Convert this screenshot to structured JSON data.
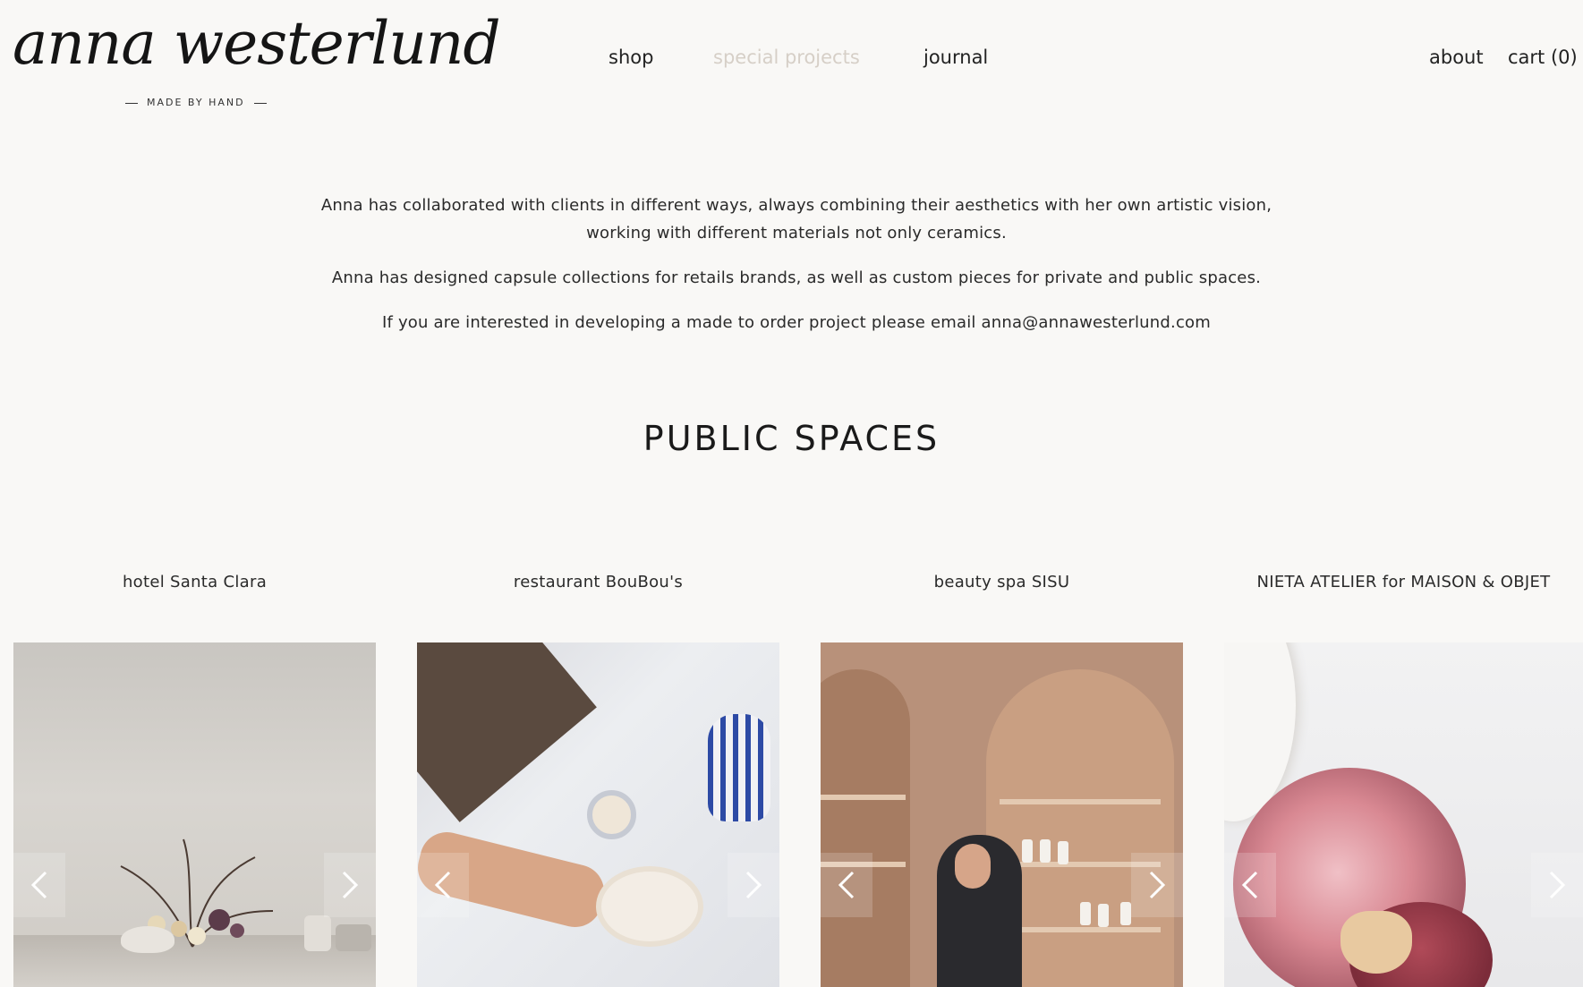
{
  "brand": {
    "name": "anna westerlund",
    "tagline": "MADE BY HAND"
  },
  "nav": {
    "shop": "shop",
    "special_projects": "special projects",
    "journal": "journal",
    "about": "about",
    "cart": "cart (0)"
  },
  "intro": {
    "p1": "Anna has collaborated with clients in different ways, always combining their aesthetics with her own artistic vision, working with different materials not only ceramics.",
    "p2": "Anna has designed capsule collections for retails brands, as well as custom pieces for private and public spaces.",
    "p3": "If you are interested in developing a made to order project please email anna@annawesterlund.com"
  },
  "section": {
    "title": "PUBLIC SPACES"
  },
  "projects": [
    {
      "label": "hotel Santa Clara"
    },
    {
      "label": "restaurant BouBou's"
    },
    {
      "label": "beauty spa SISU"
    },
    {
      "label": "NIETA ATELIER for MAISON & OBJET"
    }
  ],
  "colors": {
    "background": "#f9f8f6",
    "text": "#1b1b1b",
    "muted_nav": "#d6cfc7"
  },
  "icons": {
    "prev": "chevron-left-icon",
    "next": "chevron-right-icon"
  }
}
